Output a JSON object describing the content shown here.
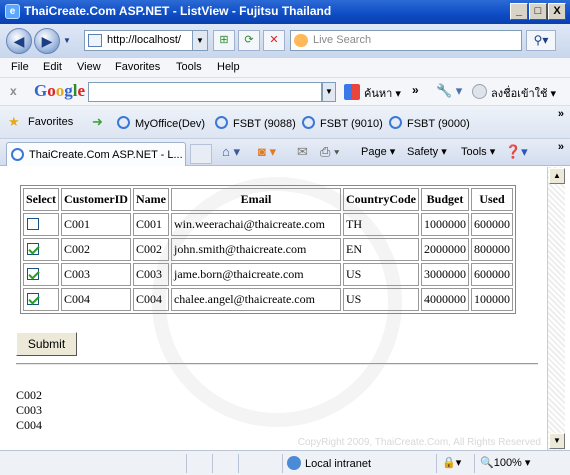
{
  "window": {
    "title": "ThaiCreate.Com ASP.NET - ListView - Fujitsu Thailand",
    "minimize": "_",
    "maximize": "□",
    "close": "X"
  },
  "address_bar": {
    "url": "http://localhost/",
    "search_placeholder": "Live Search"
  },
  "menu": [
    "File",
    "Edit",
    "View",
    "Favorites",
    "Tools",
    "Help"
  ],
  "google_toolbar": {
    "logo": "Google",
    "search_label": "ค้นหา",
    "signin_label": "ลงชื่อเข้าใช้"
  },
  "favorites_bar": {
    "label": "Favorites",
    "items": [
      "MyOffice(Dev)",
      "FSBT (9088)",
      "FSBT (9010)",
      "FSBT (9000)"
    ]
  },
  "tab": {
    "label": "ThaiCreate.Com ASP.NET - L..."
  },
  "command_bar": {
    "page": "Page",
    "safety": "Safety",
    "tools": "Tools"
  },
  "table": {
    "headers": [
      "Select",
      "CustomerID",
      "Name",
      "Email",
      "CountryCode",
      "Budget",
      "Used"
    ],
    "rows": [
      {
        "checked": false,
        "customer_id": "C001",
        "name": "C001",
        "email": "win.weerachai@thaicreate.com",
        "country": "TH",
        "budget": "1000000",
        "used": "600000"
      },
      {
        "checked": true,
        "customer_id": "C002",
        "name": "C002",
        "email": "john.smith@thaicreate.com",
        "country": "EN",
        "budget": "2000000",
        "used": "800000"
      },
      {
        "checked": true,
        "customer_id": "C003",
        "name": "C003",
        "email": "jame.born@thaicreate.com",
        "country": "US",
        "budget": "3000000",
        "used": "600000"
      },
      {
        "checked": true,
        "customer_id": "C004",
        "name": "C004",
        "email": "chalee.angel@thaicreate.com",
        "country": "US",
        "budget": "4000000",
        "used": "100000"
      }
    ]
  },
  "submit_label": "Submit",
  "result_lines": [
    "C002",
    "C003",
    "C004"
  ],
  "copyright": "CopyRight 2009, ThaiCreate.Com, All Rights Reserved",
  "status_bar": {
    "zone": "Local intranet",
    "zoom": "100%"
  }
}
